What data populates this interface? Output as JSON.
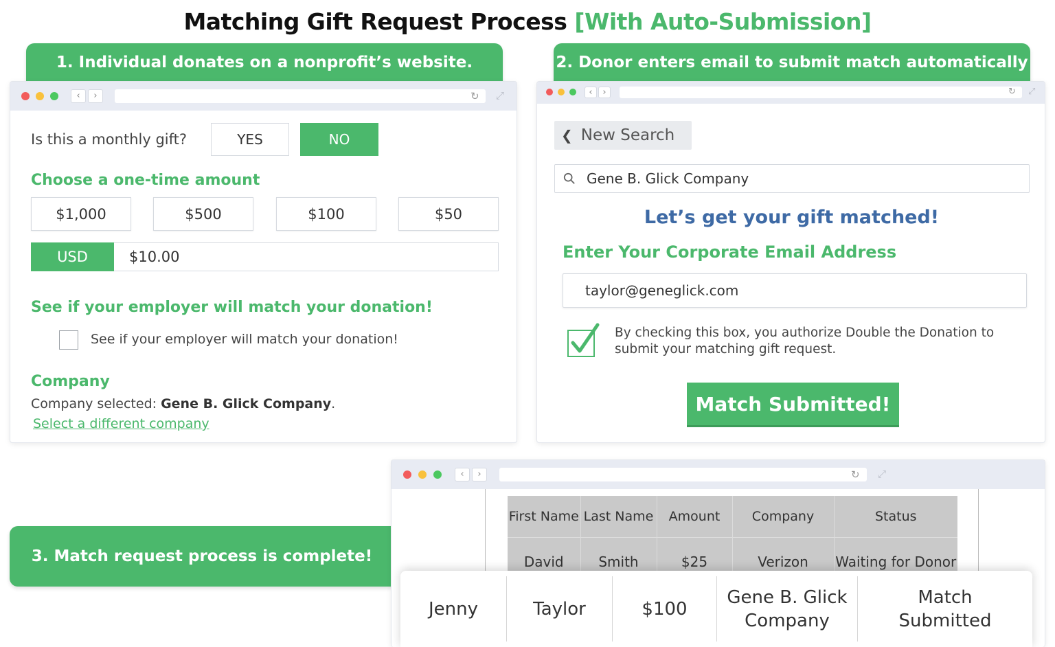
{
  "title": {
    "main": "Matching Gift Request Process",
    "accent": "[With Auto-Submission]"
  },
  "colors": {
    "green": "#4bb86c",
    "blue": "#3e6aa5"
  },
  "steps": [
    {
      "label": "1. Individual donates on a nonprofit’s website."
    },
    {
      "label": "2. Donor enters email to submit match automatically"
    },
    {
      "label": "3. Match request process is complete!"
    }
  ],
  "donation_form": {
    "monthly_question": "Is this a monthly gift?",
    "yes_label": "YES",
    "no_label": "NO",
    "one_time_heading": "Choose a one-time amount",
    "amounts": [
      "$1,000",
      "$500",
      "$100",
      "$50"
    ],
    "currency": "USD",
    "amount_value": "$10.00",
    "employer_heading": "See if your employer will match your donation!",
    "employer_checkbox_label": "See if your employer will match your donation!",
    "company_heading": "Company",
    "company_selected_prefix": "Company selected: ",
    "company_selected_name": "Gene B. Glick Company",
    "company_selected_suffix": ".",
    "change_company_link": "Select a different company"
  },
  "match_form": {
    "new_search_label": "New Search",
    "search_value": "Gene B. Glick Company",
    "heading": "Let’s get your gift matched!",
    "email_heading": "Enter Your Corporate Email Address",
    "email_value": "taylor@geneglick.com",
    "authorize_text": "By checking this box, you authorize Double the Donation to submit your matching gift request.",
    "submit_label": "Match Submitted!"
  },
  "table": {
    "headers": [
      "First Name",
      "Last Name",
      "Amount",
      "Company",
      "Status"
    ],
    "row": [
      "David",
      "Smith",
      "$25",
      "Verizon",
      "Waiting for Donor"
    ],
    "highlight_row": [
      "Jenny",
      "Taylor",
      "$100",
      "Gene B. Glick Company",
      "Match Submitted"
    ]
  },
  "icons": [
    "chevron-left-icon",
    "chevron-right-icon",
    "reload-icon",
    "expand-icon",
    "search-icon",
    "checkmark-icon"
  ]
}
